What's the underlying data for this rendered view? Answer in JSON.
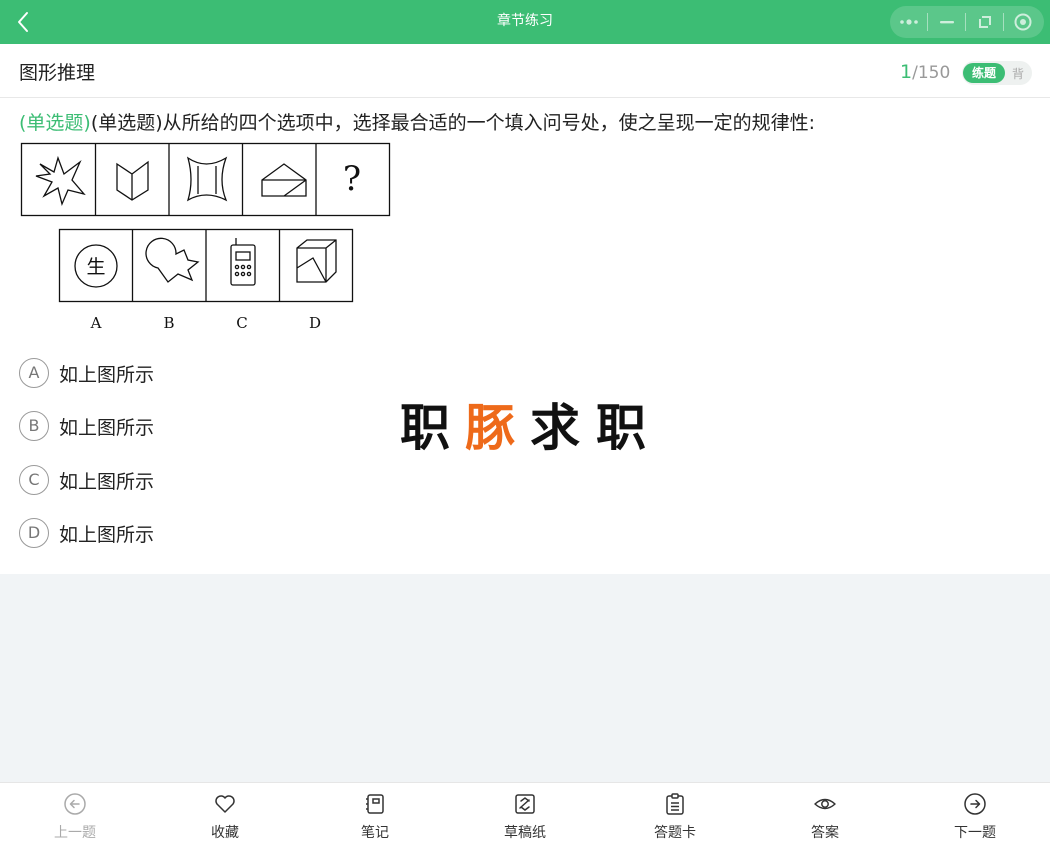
{
  "nav": {
    "title": "章节练习"
  },
  "header": {
    "section_title": "图形推理",
    "progress_current": "1",
    "progress_total": "/150",
    "mode_active": "练题",
    "mode_inactive": "背"
  },
  "question": {
    "type_tag": "(单选题)",
    "text": "(单选题)从所给的四个选项中，选择最合适的一个填入问号处，使之呈现一定的规律性:",
    "figure": {
      "top_row_last": "?",
      "option_chars": [
        "生"
      ],
      "option_labels": [
        "A",
        "B",
        "C",
        "D"
      ]
    }
  },
  "options": [
    {
      "letter": "A",
      "text": "如上图所示"
    },
    {
      "letter": "B",
      "text": "如上图所示"
    },
    {
      "letter": "C",
      "text": "如上图所示"
    },
    {
      "letter": "D",
      "text": "如上图所示"
    }
  ],
  "watermark": {
    "chars": [
      "职",
      "豚",
      "求",
      "职"
    ],
    "accent_color": "#ee6a1a"
  },
  "bottom_bar": [
    {
      "label": "上一题",
      "icon": "arrow-left-circle-icon",
      "disabled": true
    },
    {
      "label": "收藏",
      "icon": "heart-icon"
    },
    {
      "label": "笔记",
      "icon": "notebook-icon"
    },
    {
      "label": "草稿纸",
      "icon": "draft-paper-icon"
    },
    {
      "label": "答题卡",
      "icon": "answer-card-icon"
    },
    {
      "label": "答案",
      "icon": "eye-icon"
    },
    {
      "label": "下一题",
      "icon": "arrow-right-circle-icon"
    }
  ],
  "colors": {
    "brand_green": "#3cbd74",
    "page_bg": "#f1f4f6"
  }
}
